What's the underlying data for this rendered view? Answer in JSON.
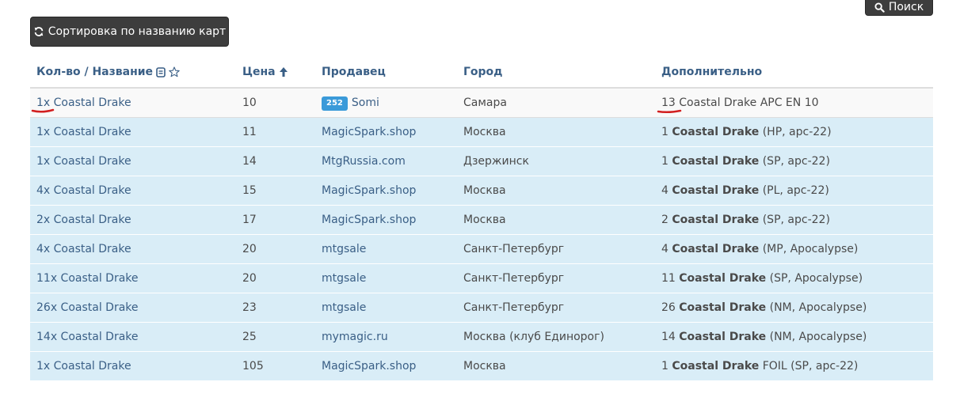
{
  "toolbar": {
    "search_label": "Поиск",
    "sort_label": "Сортировка по названию карт"
  },
  "table": {
    "headers": {
      "name": "Кол-во / Название",
      "price": "Цена",
      "seller": "Продавец",
      "city": "Город",
      "extra": "Дополнительно"
    },
    "rows": [
      {
        "name": "1x Coastal Drake",
        "price": "10",
        "seller_badge": "252",
        "seller": "Somi",
        "city": "Самара",
        "extra_qty": "13",
        "extra_title": "Coastal Drake APC EN 10",
        "extra_details": ""
      },
      {
        "name": "1x Coastal Drake",
        "price": "11",
        "seller": "MagicSpark.shop",
        "city": "Москва",
        "extra_qty": "1",
        "extra_title": "Coastal Drake",
        "extra_details": "(HP, apc-22)"
      },
      {
        "name": "1x Coastal Drake",
        "price": "14",
        "seller": "MtgRussia.com",
        "city": "Дзержинск",
        "extra_qty": "1",
        "extra_title": "Coastal Drake",
        "extra_details": "(SP, apc-22)"
      },
      {
        "name": "4x Coastal Drake",
        "price": "15",
        "seller": "MagicSpark.shop",
        "city": "Москва",
        "extra_qty": "4",
        "extra_title": "Coastal Drake",
        "extra_details": "(PL, apc-22)"
      },
      {
        "name": "2x Coastal Drake",
        "price": "17",
        "seller": "MagicSpark.shop",
        "city": "Москва",
        "extra_qty": "2",
        "extra_title": "Coastal Drake",
        "extra_details": "(SP, apc-22)"
      },
      {
        "name": "4x Coastal Drake",
        "price": "20",
        "seller": "mtgsale",
        "city": "Санкт-Петербург",
        "extra_qty": "4",
        "extra_title": "Coastal Drake",
        "extra_details": "(MP, Apocalypse)"
      },
      {
        "name": "11x Coastal Drake",
        "price": "20",
        "seller": "mtgsale",
        "city": "Санкт-Петербург",
        "extra_qty": "11",
        "extra_title": "Coastal Drake",
        "extra_details": "(SP, Apocalypse)"
      },
      {
        "name": "26x Coastal Drake",
        "price": "23",
        "seller": "mtgsale",
        "city": "Санкт-Петербург",
        "extra_qty": "26",
        "extra_title": "Coastal Drake",
        "extra_details": "(NM, Apocalypse)"
      },
      {
        "name": "14x Coastal Drake",
        "price": "25",
        "seller": "mymagic.ru",
        "city": "Москва (клуб Единорог)",
        "extra_qty": "14",
        "extra_title": "Coastal Drake",
        "extra_details": "(NM, Apocalypse)"
      },
      {
        "name": "1x Coastal Drake",
        "price": "105",
        "seller": "MagicSpark.shop",
        "city": "Москва",
        "extra_qty": "1",
        "extra_title": "Coastal Drake",
        "extra_details": "FOIL (SP, apc-22)"
      }
    ]
  },
  "colors": {
    "header_link": "#3a5f86",
    "row_info_bg": "#d9edf7",
    "badge_bg": "#3a9ad9",
    "annotation_red": "#d21f1f"
  }
}
